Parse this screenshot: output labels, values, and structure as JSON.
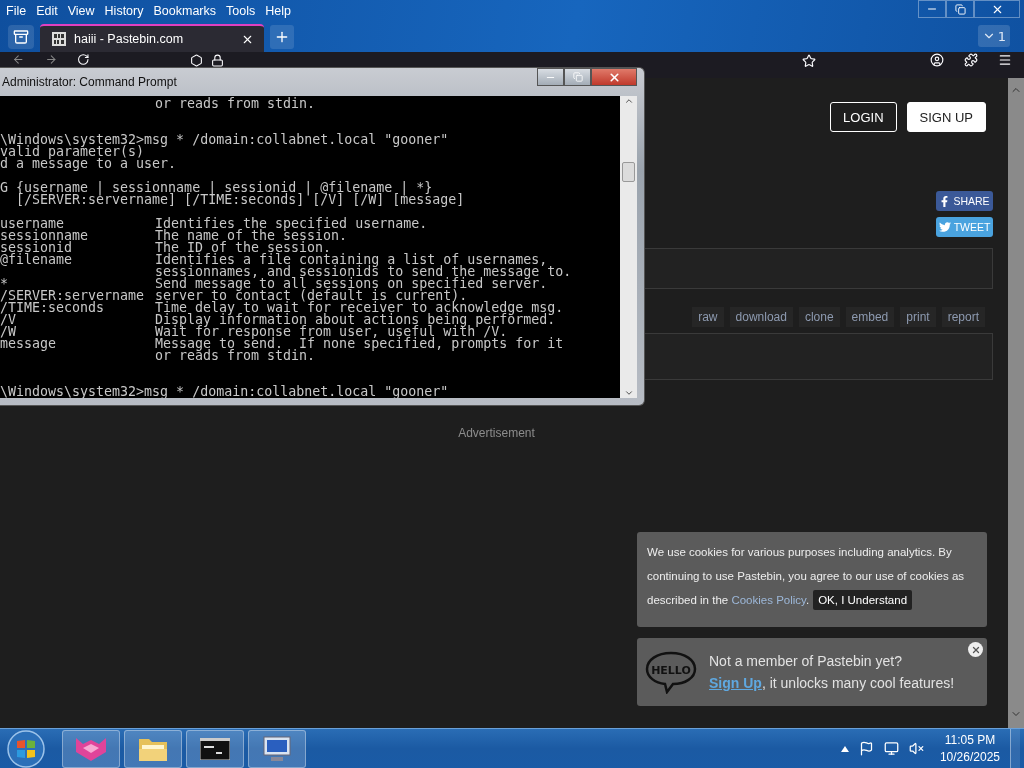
{
  "browser": {
    "menu": [
      "File",
      "Edit",
      "View",
      "History",
      "Bookmarks",
      "Tools",
      "Help"
    ],
    "tabs": [
      {
        "title": "haiii - Pastebin.com",
        "selected": true
      }
    ],
    "tab_count": "1"
  },
  "page": {
    "login": "LOGIN",
    "signup": "SIGN UP",
    "share": [
      {
        "kind": "facebook",
        "label": "SHARE"
      },
      {
        "kind": "twitter",
        "label": "TWEET"
      }
    ],
    "paste_actions": [
      "raw",
      "download",
      "clone",
      "embed",
      "print",
      "report"
    ],
    "advertisement": "Advertisement"
  },
  "command_prompt": {
    "title": "Administrator: Command Prompt",
    "lines": [
      {
        "kind": "option",
        "description": "or reads from stdin."
      },
      {
        "kind": "blank"
      },
      {
        "kind": "blank"
      },
      {
        "kind": "line",
        "text": "\\Windows\\system32>msg * /domain:collabnet.local \"gooner\""
      },
      {
        "kind": "line",
        "text": "valid parameter(s)"
      },
      {
        "kind": "line",
        "text": "d a message to a user."
      },
      {
        "kind": "blank"
      },
      {
        "kind": "line",
        "text": "G {username | sessionname | sessionid | @filename | *}"
      },
      {
        "kind": "line",
        "text": "  [/SERVER:servername] [/TIME:seconds] [/V] [/W] [message]"
      },
      {
        "kind": "blank"
      },
      {
        "kind": "option",
        "term": "username",
        "description": "Identifies the specified username."
      },
      {
        "kind": "option",
        "term": "sessionname",
        "description": "The name of the session."
      },
      {
        "kind": "option",
        "term": "sessionid",
        "description": "The ID of the session."
      },
      {
        "kind": "option",
        "term": "@filename",
        "description": "Identifies a file containing a list of usernames,"
      },
      {
        "kind": "option",
        "description": "sessionnames, and sessionids to send the message to."
      },
      {
        "kind": "option",
        "term": "*",
        "description": "Send message to all sessions on specified server."
      },
      {
        "kind": "option",
        "term": "/SERVER:servername",
        "description": "server to contact (default is current)."
      },
      {
        "kind": "option",
        "term": "/TIME:seconds",
        "description": "Time delay to wait for receiver to acknowledge msg."
      },
      {
        "kind": "option",
        "term": "/V",
        "description": "Display information about actions being performed."
      },
      {
        "kind": "option",
        "term": "/W",
        "description": "Wait for response from user, useful with /V."
      },
      {
        "kind": "option",
        "term": "message",
        "description": "Message to send.  If none specified, prompts for it"
      },
      {
        "kind": "option",
        "description": "or reads from stdin."
      },
      {
        "kind": "blank"
      },
      {
        "kind": "blank"
      },
      {
        "kind": "line",
        "text": "\\Windows\\system32>msg * /domain:collabnet.local \"gooner\""
      }
    ]
  },
  "cookie_notice": {
    "text": "We use cookies for various purposes including analytics. By continuing to use Pastebin, you agree to our use of cookies as described in the ",
    "link": "Cookies Policy",
    "after": ".",
    "button": "OK, I Understand"
  },
  "signup_prompt": {
    "badge": "HELLO",
    "title": "Not a member of Pastebin yet?",
    "link": "Sign Up",
    "text": ", it unlocks many cool features!"
  },
  "taskbar": {
    "time": "11:05 PM",
    "date": "10/26/2025"
  }
}
